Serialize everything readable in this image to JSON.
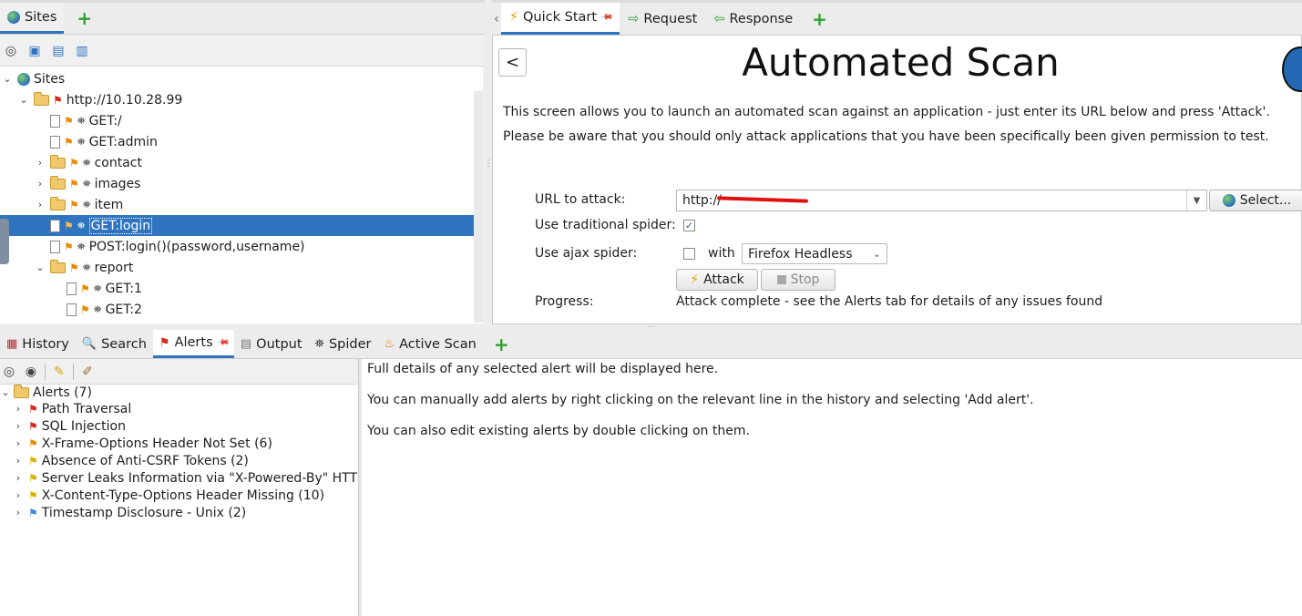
{
  "sites_panel": {
    "tab_label": "Sites",
    "tree": [
      {
        "label": "Sites",
        "depth": 0,
        "type": "root",
        "expand": "v"
      },
      {
        "label": "http://10.10.28.99",
        "depth": 1,
        "type": "folder",
        "flag": "red",
        "expand": "v"
      },
      {
        "label": "GET:/",
        "depth": 2,
        "type": "doc",
        "flag": "orange"
      },
      {
        "label": "GET:admin",
        "depth": 2,
        "type": "doc",
        "flag": "orange"
      },
      {
        "label": "contact",
        "depth": 2,
        "type": "folder",
        "flag": "orange",
        "expand": ">"
      },
      {
        "label": "images",
        "depth": 2,
        "type": "folder",
        "flag": "orange",
        "expand": ">"
      },
      {
        "label": "item",
        "depth": 2,
        "type": "folder",
        "flag": "orange",
        "expand": ">"
      },
      {
        "label": "GET:login",
        "depth": 2,
        "type": "doc",
        "flag": "orange",
        "selected": true
      },
      {
        "label": "POST:login()(password,username)",
        "depth": 2,
        "type": "doc",
        "flag": "orange"
      },
      {
        "label": "report",
        "depth": 2,
        "type": "folder",
        "flag": "orange",
        "expand": "v"
      },
      {
        "label": "GET:1",
        "depth": 3,
        "type": "doc",
        "flag": "orange"
      },
      {
        "label": "GET:2",
        "depth": 3,
        "type": "doc",
        "flag": "orange"
      }
    ]
  },
  "workspace_tabs": [
    {
      "label": "Quick Start",
      "icon": "lightning-icon",
      "active": true
    },
    {
      "label": "Request",
      "icon": "arrow-right-icon"
    },
    {
      "label": "Response",
      "icon": "arrow-left-icon"
    }
  ],
  "quick_start": {
    "back_label": "<",
    "title": "Automated Scan",
    "desc1": "This screen allows you to launch an automated scan against  an application - just enter its URL below and press 'Attack'.",
    "desc2": "Please be aware that you should only attack applications that you have been specifically been given permission to test.",
    "url_label": "URL to attack:",
    "url_value": "http://",
    "select_label": "Select...",
    "traditional_label": "Use traditional spider:",
    "ajax_label": "Use ajax spider:",
    "with_label": "with",
    "browser_value": "Firefox Headless",
    "attack_label": "Attack",
    "stop_label": "Stop",
    "progress_label": "Progress:",
    "progress_value": "Attack complete - see the Alerts tab for details of any issues found"
  },
  "bottom_tabs": [
    {
      "label": "History",
      "icon": "calendar-icon"
    },
    {
      "label": "Search",
      "icon": "magnifier-icon"
    },
    {
      "label": "Alerts",
      "icon": "flag-icon",
      "active": true
    },
    {
      "label": "Output",
      "icon": "document-icon"
    },
    {
      "label": "Spider",
      "icon": "spider-icon"
    },
    {
      "label": "Active Scan",
      "icon": "flame-icon"
    }
  ],
  "alerts": {
    "root_label": "Alerts (7)",
    "items": [
      {
        "label": "Path Traversal",
        "flag": "red"
      },
      {
        "label": "SQL Injection",
        "flag": "red"
      },
      {
        "label": "X-Frame-Options Header Not Set (6)",
        "flag": "orange"
      },
      {
        "label": "Absence of Anti-CSRF Tokens (2)",
        "flag": "yellow"
      },
      {
        "label": "Server Leaks Information via \"X-Powered-By\" HTTP",
        "flag": "yellow"
      },
      {
        "label": "X-Content-Type-Options Header Missing (10)",
        "flag": "yellow"
      },
      {
        "label": "Timestamp Disclosure - Unix (2)",
        "flag": "blue"
      }
    ],
    "detail_line1": "Full details of any selected alert will be displayed here.",
    "detail_line2": "You can manually add alerts by right clicking on the relevant line in the history and selecting 'Add alert'.",
    "detail_line3": "You can also edit existing alerts by double clicking on them."
  },
  "colors": {
    "selection": "#2f74c0",
    "accent": "#2f74c0"
  }
}
